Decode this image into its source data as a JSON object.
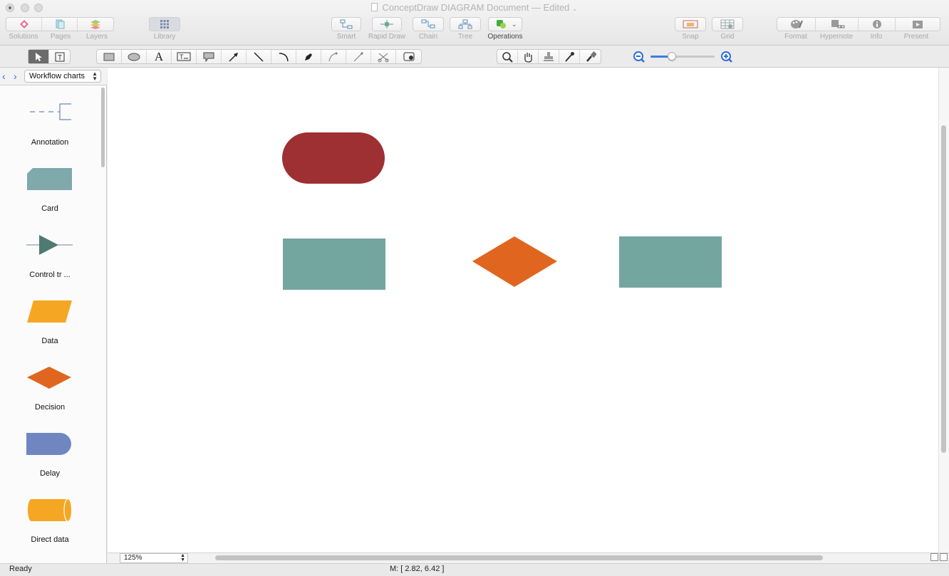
{
  "window": {
    "title": "ConceptDraw DIAGRAM Document",
    "edited_label": "— Edited"
  },
  "toolbar": {
    "solutions": "Solutions",
    "pages": "Pages",
    "layers": "Layers",
    "library": "Library",
    "smart": "Smart",
    "rapid_draw": "Rapid Draw",
    "chain": "Chain",
    "tree": "Tree",
    "operations": "Operations",
    "snap": "Snap",
    "grid": "Grid",
    "format": "Format",
    "hypernote": "Hypernote",
    "info": "Info",
    "present": "Present"
  },
  "zoom_slider": {
    "level": 0.33
  },
  "library": {
    "selected": "Workflow charts",
    "items": [
      {
        "label": "Annotation",
        "icon": "annotation-shape-icon",
        "color": "#6f86b8"
      },
      {
        "label": "Card",
        "icon": "card-shape-icon",
        "color": "#7fa9aa"
      },
      {
        "label": "Control tr ...",
        "icon": "control-transfer-shape-icon",
        "color": "#4f7a72"
      },
      {
        "label": "Data",
        "icon": "data-shape-icon",
        "color": "#f5a623"
      },
      {
        "label": "Decision",
        "icon": "decision-shape-icon",
        "color": "#e0661f"
      },
      {
        "label": "Delay",
        "icon": "delay-shape-icon",
        "color": "#6f86c0"
      },
      {
        "label": "Direct data",
        "icon": "direct-data-shape-icon",
        "color": "#f5a623"
      }
    ]
  },
  "canvas": {
    "shapes": [
      {
        "type": "terminator",
        "color": "#9e2f33"
      },
      {
        "type": "process",
        "color": "#73a69f"
      },
      {
        "type": "decision",
        "color": "#e0661f"
      },
      {
        "type": "process",
        "color": "#73a69f"
      }
    ]
  },
  "zoom": {
    "value": "125%"
  },
  "status": {
    "text": "Ready",
    "mouse": "M: [ 2.82, 6.42 ]"
  }
}
